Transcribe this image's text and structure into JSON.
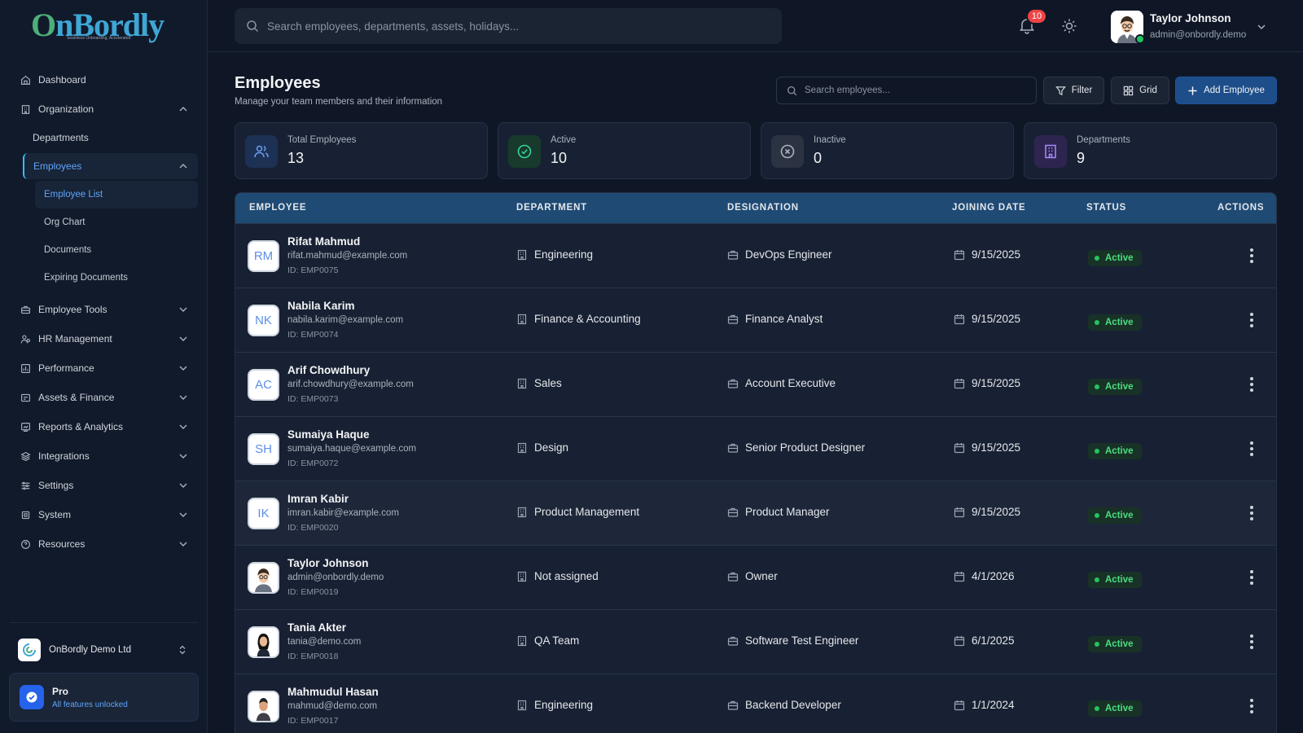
{
  "brand": {
    "name": "OnBordly",
    "tagline": "Seamless Onboarding, Accelerated"
  },
  "sidebar": {
    "dashboard": "Dashboard",
    "organization": "Organization",
    "departments": "Departments",
    "employees": "Employees",
    "employee_list": "Employee List",
    "org_chart": "Org Chart",
    "documents": "Documents",
    "expiring_documents": "Expiring Documents",
    "employee_tools": "Employee Tools",
    "hr_management": "HR Management",
    "performance": "Performance",
    "assets_finance": "Assets & Finance",
    "reports_analytics": "Reports & Analytics",
    "integrations": "Integrations",
    "settings": "Settings",
    "system": "System",
    "resources": "Resources",
    "org_name": "OnBordly Demo Ltd",
    "plan_title": "Pro",
    "plan_sub": "All features unlocked"
  },
  "topbar": {
    "search_placeholder": "Search employees, departments, assets, holidays...",
    "notifications_count": "10",
    "user_name": "Taylor Johnson",
    "user_email": "admin@onbordly.demo"
  },
  "page": {
    "title": "Employees",
    "subtitle": "Manage your team members and their information",
    "search_placeholder": "Search employees...",
    "filter_label": "Filter",
    "grid_label": "Grid",
    "add_label": "Add Employee"
  },
  "stats": {
    "total_label": "Total Employees",
    "total_value": "13",
    "active_label": "Active",
    "active_value": "10",
    "inactive_label": "Inactive",
    "inactive_value": "0",
    "departments_label": "Departments",
    "departments_value": "9"
  },
  "table": {
    "headers": {
      "employee": "EMPLOYEE",
      "department": "DEPARTMENT",
      "designation": "DESIGNATION",
      "joining_date": "JOINING DATE",
      "status": "STATUS",
      "actions": "ACTIONS"
    },
    "rows": [
      {
        "initials": "RM",
        "name": "Rifat Mahmud",
        "email": "rifat.mahmud@example.com",
        "id": "ID: EMP0075",
        "department": "Engineering",
        "designation": "DevOps Engineer",
        "joining_date": "9/15/2025",
        "status": "Active"
      },
      {
        "initials": "NK",
        "name": "Nabila Karim",
        "email": "nabila.karim@example.com",
        "id": "ID: EMP0074",
        "department": "Finance & Accounting",
        "designation": "Finance Analyst",
        "joining_date": "9/15/2025",
        "status": "Active"
      },
      {
        "initials": "AC",
        "name": "Arif Chowdhury",
        "email": "arif.chowdhury@example.com",
        "id": "ID: EMP0073",
        "department": "Sales",
        "designation": "Account Executive",
        "joining_date": "9/15/2025",
        "status": "Active"
      },
      {
        "initials": "SH",
        "name": "Sumaiya Haque",
        "email": "sumaiya.haque@example.com",
        "id": "ID: EMP0072",
        "department": "Design",
        "designation": "Senior Product Designer",
        "joining_date": "9/15/2025",
        "status": "Active"
      },
      {
        "initials": "IK",
        "name": "Imran Kabir",
        "email": "imran.kabir@example.com",
        "id": "ID: EMP0020",
        "department": "Product Management",
        "designation": "Product Manager",
        "joining_date": "9/15/2025",
        "status": "Active"
      },
      {
        "initials": "",
        "name": "Taylor Johnson",
        "email": "admin@onbordly.demo",
        "id": "ID: EMP0019",
        "department": "Not assigned",
        "designation": "Owner",
        "joining_date": "4/1/2026",
        "status": "Active"
      },
      {
        "initials": "",
        "name": "Tania Akter",
        "email": "tania@demo.com",
        "id": "ID: EMP0018",
        "department": "QA Team",
        "designation": "Software Test Engineer",
        "joining_date": "6/1/2025",
        "status": "Active"
      },
      {
        "initials": "",
        "name": "Mahmudul Hasan",
        "email": "mahmud@demo.com",
        "id": "ID: EMP0017",
        "department": "Engineering",
        "designation": "Backend Developer",
        "joining_date": "1/1/2024",
        "status": "Active"
      }
    ]
  }
}
